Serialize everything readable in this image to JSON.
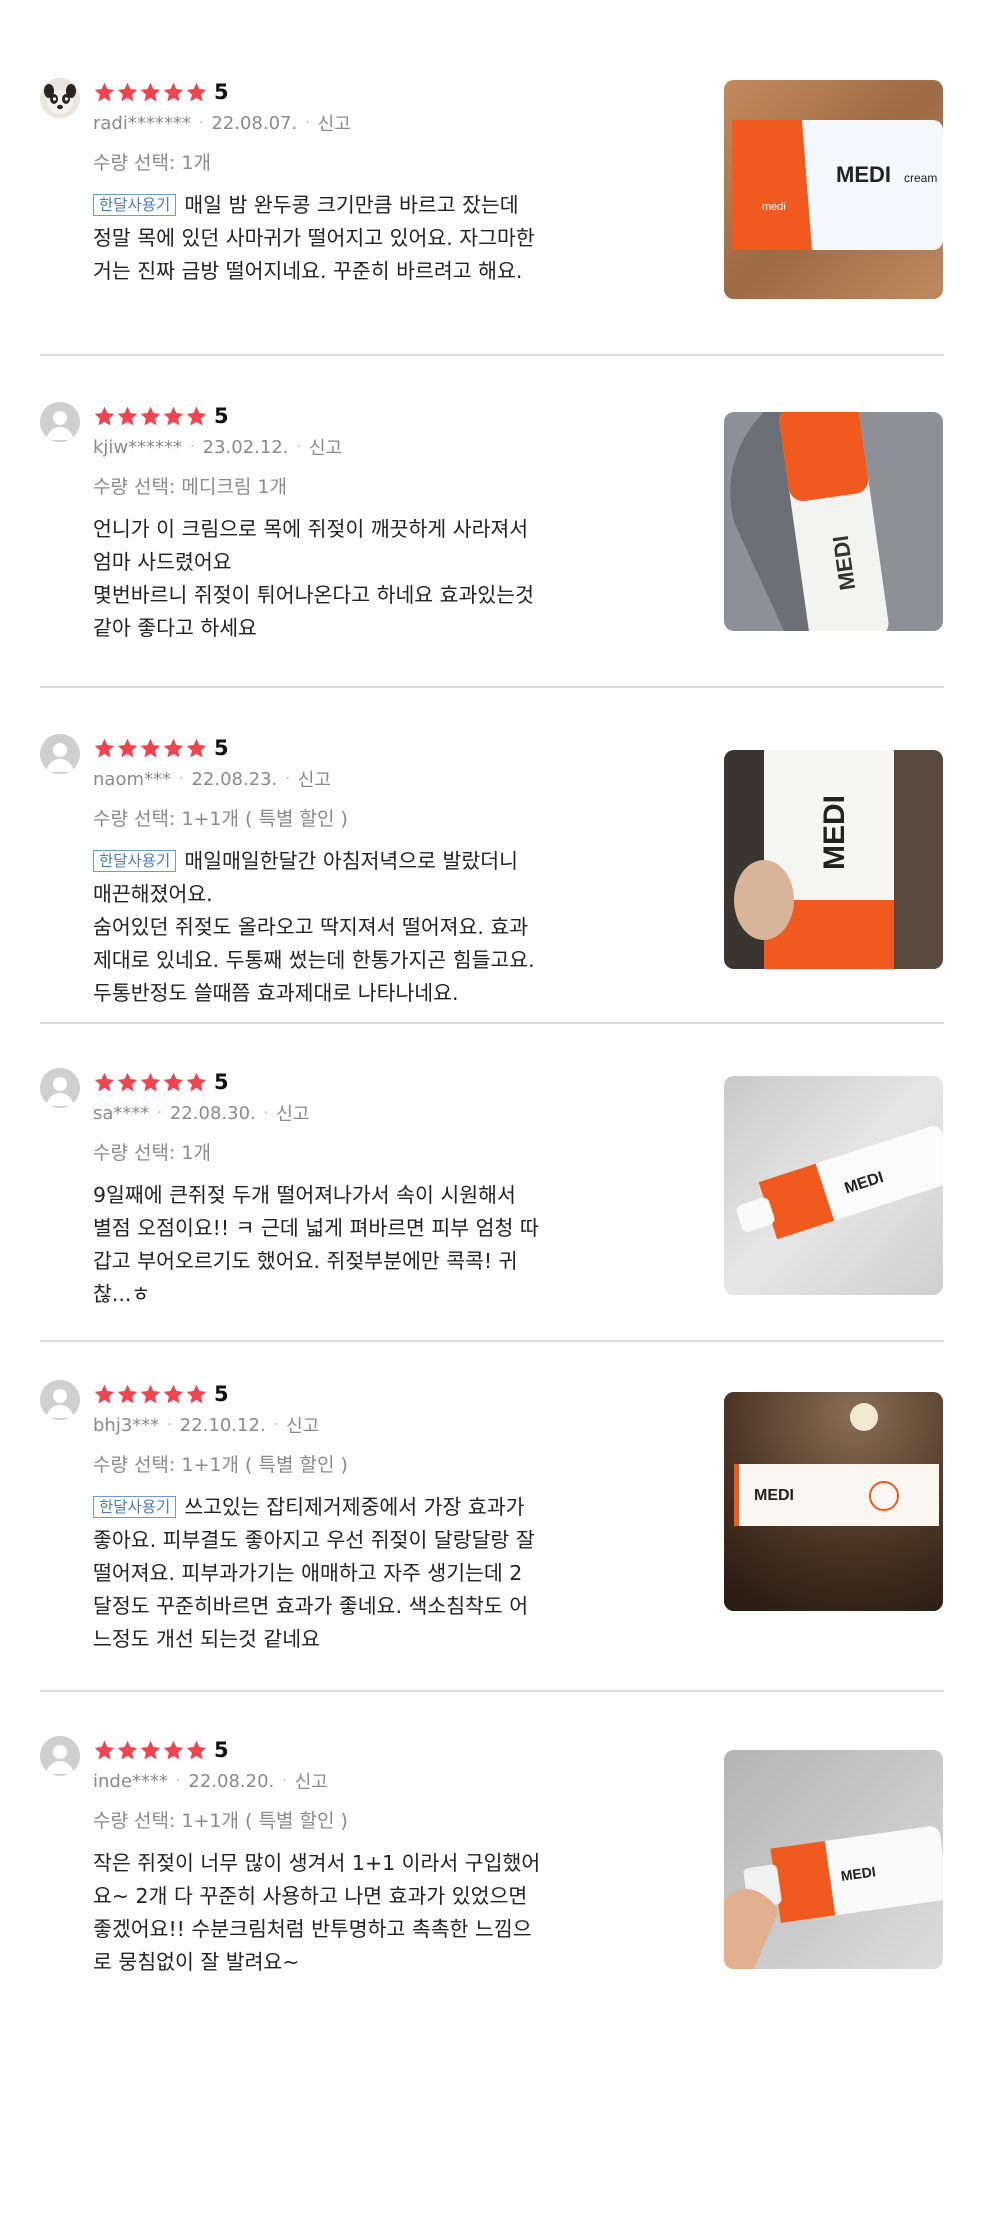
{
  "reviews": [
    {
      "rating": "5",
      "user": "radi*******",
      "date": "22.08.07.",
      "report": "신고",
      "option": "수량 선택: 1개",
      "tag": "한달사용기",
      "text": "매일 밤 완두콩 크기만큼 바르고 잤는데\n정말 목에 있던 사마귀가 떨어지고 있어요. 자그마한\n거는 진짜 금방 떨어지네요. 꾸준히 바르려고 해요.",
      "avatar_icon": "dog-avatar-icon",
      "photo": {
        "brand": "medi",
        "product": "MEDI cream",
        "bg": "#b07a52"
      }
    },
    {
      "rating": "5",
      "user": "kjiw******",
      "date": "23.02.12.",
      "report": "신고",
      "option": "수량 선택: 메디크림 1개",
      "tag": "",
      "text": "언니가 이 크림으로 목에 쥐젖이 깨끗하게 사라져서\n엄마 사드렸어요\n몇번바르니 쥐젖이 튀어나온다고 하네요 효과있는것\n같아 좋다고 하세요",
      "avatar_icon": "user-avatar-icon",
      "photo": {
        "brand": "medi",
        "product": "MEDI cream",
        "bg": "#8d9096"
      }
    },
    {
      "rating": "5",
      "user": "naom***",
      "date": "22.08.23.",
      "report": "신고",
      "option": "수량 선택: 1+1개 ( 특별 할인 )",
      "tag": "한달사용기",
      "text": "매일매일한달간 아침저녁으로 발랐더니\n매끈해졌어요.\n숨어있던 쥐젖도 올라오고 딱지져서 떨어져요. 효과\n제대로 있네요. 두통째 썼는데 한통가지곤 힘들고요.\n두통반정도 쓸때쯤 효과제대로 나타나네요.",
      "avatar_icon": "user-avatar-icon",
      "photo": {
        "brand": "medi",
        "product": "MEDI cream",
        "bg": "#3a3530"
      }
    },
    {
      "rating": "5",
      "user": "sa****",
      "date": "22.08.30.",
      "report": "신고",
      "option": "수량 선택: 1개",
      "tag": "",
      "text": "9일째에 큰쥐젖 두개 떨어져나가서 속이 시원해서\n별점 오점이요!! ㅋ 근데 넓게 펴바르면 피부 엄청 따\n갑고 부어오르기도 했어요. 쥐젖부분에만 콕콕! 귀\n찮...ㅎ",
      "avatar_icon": "user-avatar-icon",
      "photo": {
        "brand": "medi",
        "product": "MEDI cream",
        "bg": "#d8d8d8"
      }
    },
    {
      "rating": "5",
      "user": "bhj3***",
      "date": "22.10.12.",
      "report": "신고",
      "option": "수량 선택: 1+1개 ( 특별 할인 )",
      "tag": "한달사용기",
      "text": "쓰고있는 잡티제거제중에서 가장 효과가\n좋아요. 피부결도 좋아지고 우선 쥐젖이 달랑달랑 잘\n떨어져요. 피부과가기는 애매하고 자주 생기는데 2\n달정도 꾸준히바르면 효과가 좋네요. 색소침착도 어\n느정도 개선 되는것 같네요",
      "avatar_icon": "user-avatar-icon",
      "photo": {
        "brand": "medi",
        "product": "MEDI cream",
        "bg": "#4a3424"
      }
    },
    {
      "rating": "5",
      "user": "inde****",
      "date": "22.08.20.",
      "report": "신고",
      "option": "수량 선택: 1+1개 ( 특별 할인 )",
      "tag": "",
      "text": "작은 쥐젖이 너무 많이 생겨서 1+1 이라서 구입했어\n요~ 2개 다 꾸준히 사용하고 나면 효과가 있었으면\n좋겠어요!! 수분크림처럼 반투명하고 촉촉한 느낌으\n로 뭉침없이  잘 발려요~",
      "avatar_icon": "user-avatar-icon",
      "photo": {
        "brand": "medi",
        "product": "MEDI cream",
        "bg": "#bdbdbd"
      }
    }
  ],
  "colors": {
    "star": "#f0444f",
    "tag": "#4a79c9",
    "divider": "#d8d8d8",
    "accent_orange": "#f05a1e"
  }
}
